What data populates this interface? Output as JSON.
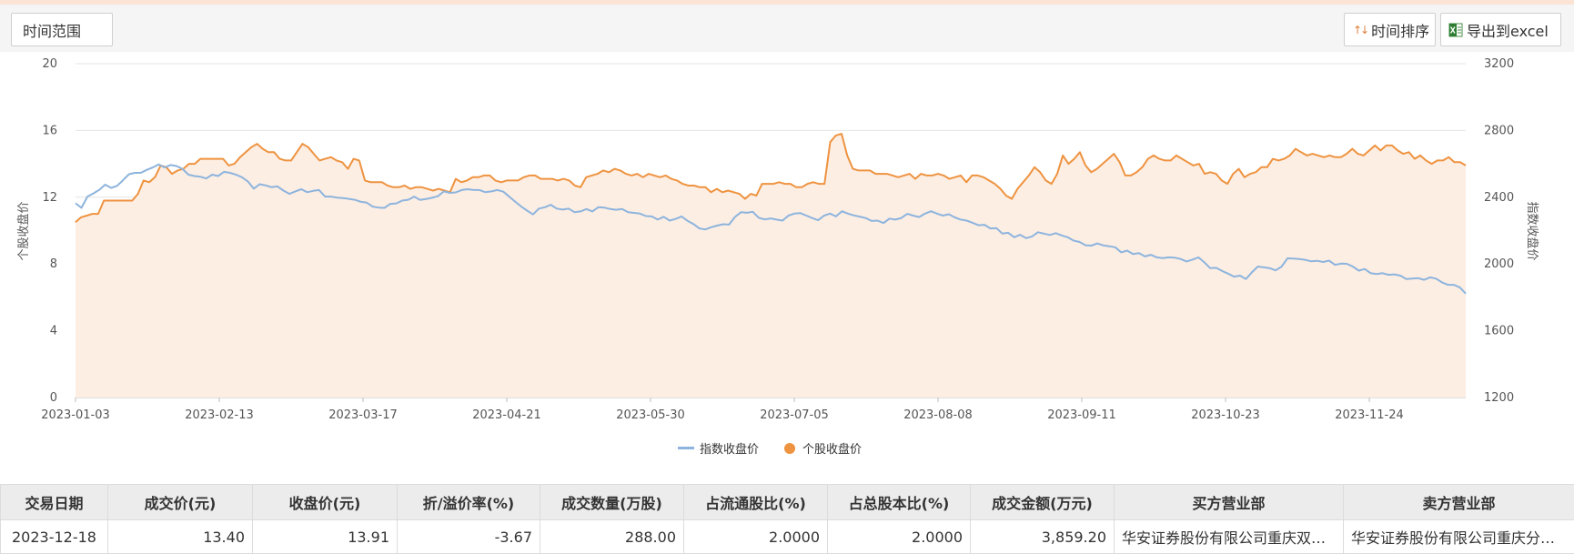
{
  "toolbar": {
    "time_range_label": "时间范围",
    "sort_label": "时间排序",
    "export_label": "导出到excel"
  },
  "colors": {
    "index_line": "#8db4dd",
    "stock_line": "#ee9340",
    "stock_area": "#fdeee4",
    "grid": "#e6e6e6"
  },
  "chart_data": {
    "type": "line",
    "y_left": {
      "label": "个股收盘价",
      "min": 0,
      "max": 20,
      "ticks": [
        0,
        4,
        8,
        12,
        16,
        20
      ]
    },
    "y_right": {
      "label": "指数收盘价",
      "min": 1200,
      "max": 3200,
      "ticks": [
        1200,
        1600,
        2000,
        2400,
        2800,
        3200
      ]
    },
    "x_ticks": [
      "2023-01-03",
      "2023-02-13",
      "2023-03-17",
      "2023-04-21",
      "2023-05-30",
      "2023-07-05",
      "2023-08-08",
      "2023-09-11",
      "2023-10-23",
      "2023-11-24"
    ],
    "grid": true,
    "legend_position": "bottom",
    "series": [
      {
        "name": "指数收盘价",
        "axis": "right",
        "style": "line",
        "values": [
          2364,
          2336,
          2404,
          2423,
          2444,
          2475,
          2456,
          2468,
          2502,
          2538,
          2546,
          2546,
          2564,
          2578,
          2597,
          2578,
          2593,
          2587,
          2570,
          2535,
          2527,
          2523,
          2512,
          2535,
          2527,
          2552,
          2546,
          2535,
          2520,
          2495,
          2451,
          2478,
          2471,
          2460,
          2465,
          2440,
          2420,
          2435,
          2448,
          2430,
          2438,
          2443,
          2404,
          2404,
          2398,
          2395,
          2390,
          2385,
          2373,
          2368,
          2344,
          2338,
          2336,
          2360,
          2363,
          2380,
          2385,
          2404,
          2384,
          2389,
          2397,
          2406,
          2435,
          2426,
          2429,
          2443,
          2448,
          2443,
          2443,
          2430,
          2435,
          2443,
          2433,
          2403,
          2374,
          2345,
          2320,
          2297,
          2332,
          2340,
          2355,
          2332,
          2326,
          2332,
          2310,
          2315,
          2329,
          2315,
          2340,
          2338,
          2329,
          2325,
          2329,
          2310,
          2306,
          2302,
          2287,
          2285,
          2266,
          2283,
          2260,
          2270,
          2285,
          2259,
          2240,
          2213,
          2207,
          2220,
          2230,
          2238,
          2236,
          2282,
          2310,
          2307,
          2313,
          2277,
          2267,
          2273,
          2266,
          2260,
          2290,
          2302,
          2305,
          2290,
          2275,
          2262,
          2290,
          2302,
          2285,
          2316,
          2302,
          2291,
          2284,
          2275,
          2258,
          2260,
          2245,
          2272,
          2266,
          2276,
          2300,
          2290,
          2281,
          2302,
          2316,
          2302,
          2290,
          2298,
          2279,
          2266,
          2260,
          2247,
          2232,
          2235,
          2213,
          2215,
          2182,
          2187,
          2160,
          2175,
          2155,
          2165,
          2190,
          2182,
          2174,
          2185,
          2171,
          2160,
          2140,
          2132,
          2112,
          2110,
          2123,
          2111,
          2106,
          2100,
          2070,
          2080,
          2060,
          2065,
          2045,
          2055,
          2040,
          2035,
          2040,
          2038,
          2030,
          2015,
          2026,
          2040,
          2010,
          1975,
          1977,
          1958,
          1942,
          1924,
          1930,
          1910,
          1950,
          1985,
          1980,
          1975,
          1962,
          1984,
          2034,
          2032,
          2030,
          2025,
          2016,
          2019,
          2012,
          2020,
          1995,
          2002,
          2001,
          1985,
          1960,
          1970,
          1945,
          1940,
          1945,
          1935,
          1938,
          1930,
          1910,
          1912,
          1915,
          1905,
          1920,
          1912,
          1890,
          1875,
          1875,
          1860,
          1823
        ]
      },
      {
        "name": "个股收盘价",
        "axis": "left",
        "style": "area-line",
        "values": [
          10.5,
          10.8,
          10.9,
          11.0,
          11.0,
          11.8,
          11.8,
          11.8,
          11.8,
          11.8,
          11.8,
          12.2,
          13.0,
          12.9,
          13.2,
          13.9,
          13.8,
          13.4,
          13.6,
          13.7,
          14.0,
          14.0,
          14.3,
          14.3,
          14.3,
          14.3,
          14.3,
          13.9,
          14.0,
          14.4,
          14.7,
          15.0,
          15.2,
          14.9,
          14.7,
          14.7,
          14.3,
          14.2,
          14.2,
          14.7,
          15.2,
          15.0,
          14.6,
          14.2,
          14.3,
          14.4,
          14.2,
          14.1,
          13.7,
          14.3,
          14.2,
          13.0,
          12.9,
          12.9,
          12.9,
          12.7,
          12.6,
          12.6,
          12.7,
          12.5,
          12.6,
          12.6,
          12.5,
          12.4,
          12.5,
          12.4,
          12.3,
          13.1,
          12.9,
          13.0,
          13.2,
          13.2,
          13.3,
          13.3,
          13.0,
          12.9,
          13.0,
          13.0,
          13.0,
          13.2,
          13.3,
          13.3,
          13.1,
          13.1,
          13.1,
          13.0,
          13.1,
          13.0,
          12.7,
          12.6,
          13.2,
          13.3,
          13.4,
          13.6,
          13.5,
          13.7,
          13.6,
          13.4,
          13.3,
          13.4,
          13.2,
          13.4,
          13.3,
          13.2,
          13.3,
          13.1,
          13.0,
          12.8,
          12.7,
          12.7,
          12.6,
          12.6,
          12.3,
          12.5,
          12.3,
          12.4,
          12.3,
          12.2,
          11.9,
          12.2,
          12.1,
          12.8,
          12.8,
          12.8,
          12.9,
          12.8,
          12.8,
          12.6,
          12.6,
          12.8,
          12.9,
          12.8,
          12.8,
          15.3,
          15.7,
          15.8,
          14.5,
          13.7,
          13.6,
          13.6,
          13.6,
          13.4,
          13.4,
          13.4,
          13.3,
          13.2,
          13.3,
          13.4,
          13.1,
          13.4,
          13.3,
          13.3,
          13.4,
          13.3,
          13.1,
          13.2,
          13.3,
          12.9,
          13.3,
          13.3,
          13.2,
          13.0,
          12.8,
          12.5,
          12.1,
          11.9,
          12.5,
          12.9,
          13.3,
          13.8,
          13.5,
          13.0,
          12.8,
          13.4,
          14.5,
          14.0,
          14.3,
          14.7,
          13.9,
          13.5,
          13.7,
          14.0,
          14.3,
          14.6,
          14.1,
          13.3,
          13.3,
          13.5,
          13.8,
          14.3,
          14.5,
          14.3,
          14.2,
          14.2,
          14.5,
          14.3,
          14.1,
          13.9,
          14.0,
          13.4,
          13.5,
          13.4,
          13.0,
          12.8,
          13.4,
          13.7,
          13.2,
          13.4,
          13.5,
          13.8,
          13.8,
          14.3,
          14.2,
          14.3,
          14.5,
          14.9,
          14.7,
          14.5,
          14.6,
          14.5,
          14.4,
          14.5,
          14.4,
          14.4,
          14.6,
          14.9,
          14.6,
          14.5,
          14.8,
          15.1,
          14.8,
          15.1,
          15.1,
          14.8,
          14.6,
          14.7,
          14.3,
          14.5,
          14.2,
          14.0,
          14.2,
          14.2,
          14.4,
          14.1,
          14.1,
          13.9
        ]
      }
    ]
  },
  "table": {
    "headers": [
      "交易日期",
      "成交价(元)",
      "收盘价(元)",
      "折/溢价率(%)",
      "成交数量(万股)",
      "占流通股比(%)",
      "占总股本比(%)",
      "成交金额(万元)",
      "买方营业部",
      "卖方营业部"
    ],
    "rows": [
      [
        "2023-12-18",
        "13.40",
        "13.91",
        "-3.67",
        "288.00",
        "2.0000",
        "2.0000",
        "3,859.20",
        "华安证券股份有限公司重庆双…",
        "华安证券股份有限公司重庆分…"
      ]
    ]
  }
}
